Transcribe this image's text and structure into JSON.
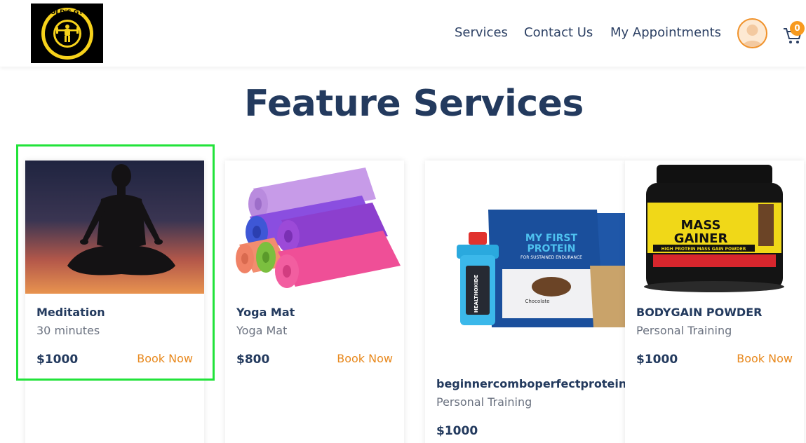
{
  "header": {
    "logo_text": "GOLD'S GYM",
    "nav": {
      "services": "Services",
      "contact": "Contact Us",
      "appointments": "My Appointments"
    },
    "cart_count": "0"
  },
  "page": {
    "title": "Feature Services"
  },
  "cards": [
    {
      "title": "Meditation",
      "subtitle": "30 minutes",
      "price": "$1000",
      "cta": "Book Now"
    },
    {
      "title": "Yoga Mat",
      "subtitle": "Yoga Mat",
      "price": "$800",
      "cta": "Book Now"
    },
    {
      "title": "beginnercomboperfectproteinfo",
      "subtitle": "Personal Training",
      "price": "$1000",
      "cta": "",
      "product_text": {
        "brand": "HEALTHOXIDE",
        "line1": "MY FIRST",
        "line2": "PROTEIN",
        "line3": "FOR SUSTAINED ENDURANCE",
        "flavor": "Chocolate"
      }
    },
    {
      "title": "BODYGAIN POWDER",
      "subtitle": "Personal Training",
      "price": "$1000",
      "cta": "Book Now",
      "product_text": {
        "line1": "MASS",
        "line2": "GAINER",
        "line3": "HIGH PROTEIN MASS GAIN POWDER"
      }
    }
  ]
}
